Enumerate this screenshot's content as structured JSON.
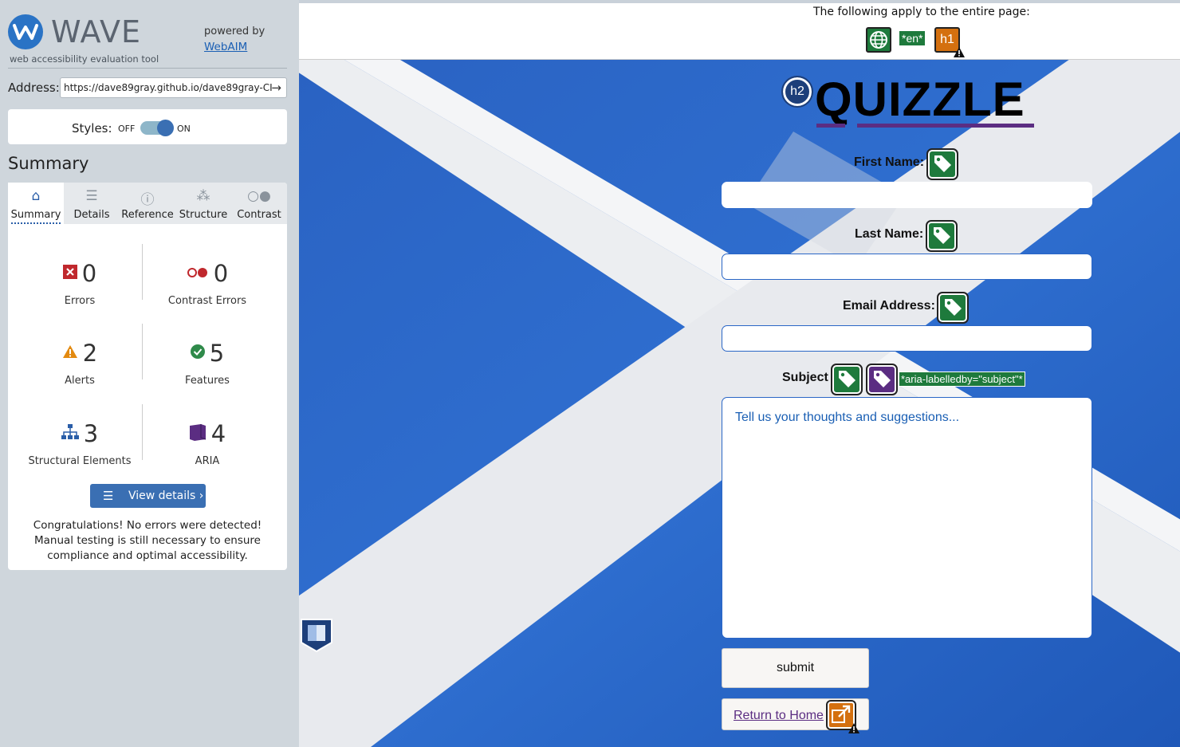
{
  "wave": {
    "logo_text": "WAVE",
    "subtitle": "web accessibility evaluation tool",
    "powered_by": "powered by",
    "webaim_link": "WebAIM"
  },
  "address": {
    "label": "Address:",
    "value": "https://dave89gray.github.io/dave89gray-CI"
  },
  "styles": {
    "label": "Styles:",
    "off": "OFF",
    "on": "ON",
    "enabled": true
  },
  "summary_title": "Summary",
  "tabs": [
    {
      "label": "Summary",
      "icon": "home-icon",
      "active": true
    },
    {
      "label": "Details",
      "icon": "list-icon",
      "active": false
    },
    {
      "label": "Reference",
      "icon": "info-icon",
      "active": false
    },
    {
      "label": "Structure",
      "icon": "hierarchy-icon",
      "active": false
    },
    {
      "label": "Contrast",
      "icon": "contrast-icon",
      "active": false
    }
  ],
  "stats": {
    "errors": {
      "value": "0",
      "label": "Errors",
      "color": "#c0282d"
    },
    "contrast_errors": {
      "value": "0",
      "label": "Contrast Errors",
      "color": "#c0282d"
    },
    "alerts": {
      "value": "2",
      "label": "Alerts",
      "color": "#e38a10"
    },
    "features": {
      "value": "5",
      "label": "Features",
      "color": "#2f8a4a"
    },
    "structural": {
      "value": "3",
      "label": "Structural Elements",
      "color": "#2a5ea8"
    },
    "aria": {
      "value": "4",
      "label": "ARIA",
      "color": "#5b2d82"
    }
  },
  "view_details": "View details ›",
  "congrats": "Congratulations! No errors were detected! Manual testing is still necessary to ensure compliance and optimal accessibility.",
  "page": {
    "banner_text": "The following apply to the entire page:",
    "lang_chip": "*en*",
    "h1_badge": "h1",
    "h2_badge": "h2",
    "title": "QUIZZLE",
    "first_name_label": "First Name:",
    "last_name_label": "Last Name:",
    "email_label": "Email Address:",
    "subject_label": "Subject",
    "aria_chip": "*aria-labelledby=\"subject\"*",
    "textarea_placeholder": "Tell us your thoughts and suggestions...",
    "submit_label": "submit",
    "home_link": "Return to Home"
  }
}
